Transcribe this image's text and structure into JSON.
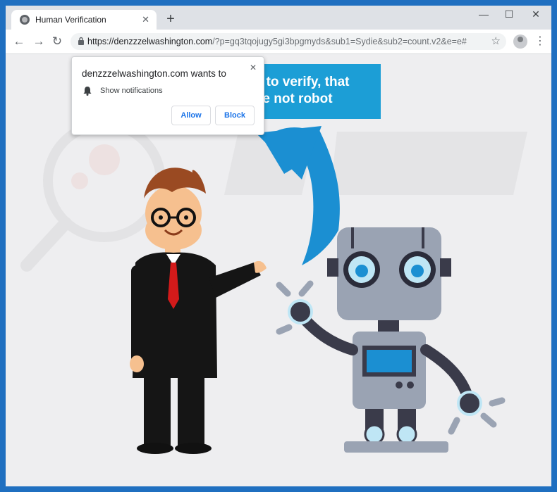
{
  "tab": {
    "title": "Human Verification",
    "close": "✕"
  },
  "tabstrip": {
    "new_tab": "+",
    "minimize": "—",
    "maximize": "☐",
    "close": "✕"
  },
  "toolbar": {
    "back": "←",
    "forward": "→",
    "reload": "↻",
    "url_domain": "https://denzzzelwashington.com",
    "url_rest": "/?p=gq3tqojugy5gi3bpgmyds&sub1=Sydie&sub2=count.v2&e=e#",
    "star": "☆",
    "menu": "⋮"
  },
  "banner": {
    "line1": "w\" to verify, that",
    "line2": "e not robot"
  },
  "popup": {
    "title": "denzzzelwashington.com wants to",
    "permission": "Show notifications",
    "allow": "Allow",
    "block": "Block",
    "close": "✕"
  },
  "colors": {
    "banner": "#1c9ed6",
    "arrow": "#1b8fd2",
    "suit": "#151515",
    "tie": "#d31a1a",
    "robot": "#9aa3b3"
  },
  "icons": [
    "globe-icon",
    "lock-icon",
    "star-icon",
    "profile-icon",
    "bell-icon",
    "kebab-menu-icon"
  ]
}
